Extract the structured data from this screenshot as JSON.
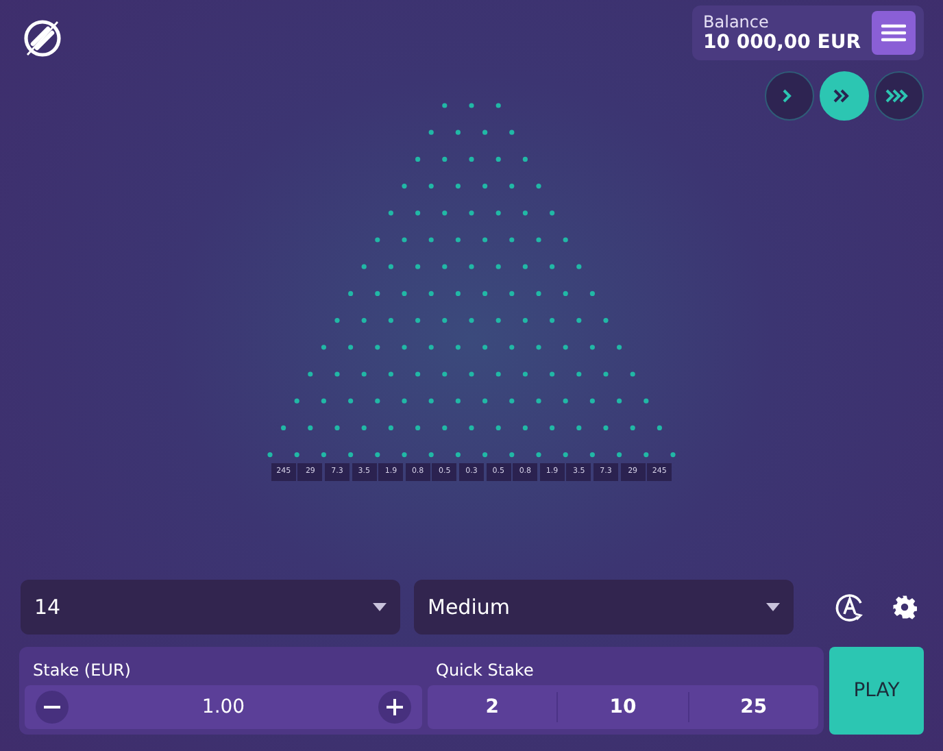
{
  "header": {
    "balance_label": "Balance",
    "balance_amount": "10 000,00 EUR"
  },
  "speed_buttons": [
    {
      "kind": "single",
      "selected": false
    },
    {
      "kind": "double",
      "selected": true
    },
    {
      "kind": "triple",
      "selected": false
    }
  ],
  "multipliers": [
    "245",
    "29",
    "7.3",
    "3.5",
    "1.9",
    "0.8",
    "0.5",
    "0.3",
    "0.5",
    "0.8",
    "1.9",
    "3.5",
    "7.3",
    "29",
    "245"
  ],
  "rows_select": {
    "value": "14"
  },
  "risk_select": {
    "value": "Medium"
  },
  "stake": {
    "label": "Stake (EUR)",
    "value": "1.00"
  },
  "quick_stake": {
    "label": "Quick Stake",
    "options": [
      "2",
      "10",
      "25"
    ]
  },
  "play_button": "PLAY"
}
